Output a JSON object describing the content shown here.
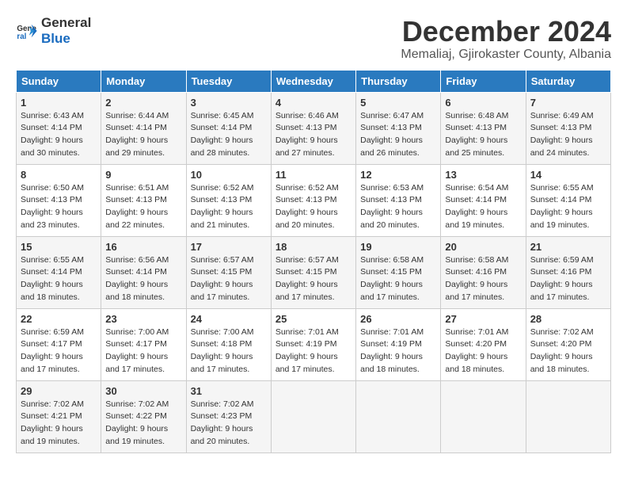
{
  "header": {
    "logo_general": "General",
    "logo_blue": "Blue",
    "month_title": "December 2024",
    "location": "Memaliaj, Gjirokaster County, Albania"
  },
  "days_of_week": [
    "Sunday",
    "Monday",
    "Tuesday",
    "Wednesday",
    "Thursday",
    "Friday",
    "Saturday"
  ],
  "weeks": [
    [
      {
        "day": "1",
        "sunrise": "6:43 AM",
        "sunset": "4:14 PM",
        "daylight": "9 hours and 30 minutes."
      },
      {
        "day": "2",
        "sunrise": "6:44 AM",
        "sunset": "4:14 PM",
        "daylight": "9 hours and 29 minutes."
      },
      {
        "day": "3",
        "sunrise": "6:45 AM",
        "sunset": "4:14 PM",
        "daylight": "9 hours and 28 minutes."
      },
      {
        "day": "4",
        "sunrise": "6:46 AM",
        "sunset": "4:13 PM",
        "daylight": "9 hours and 27 minutes."
      },
      {
        "day": "5",
        "sunrise": "6:47 AM",
        "sunset": "4:13 PM",
        "daylight": "9 hours and 26 minutes."
      },
      {
        "day": "6",
        "sunrise": "6:48 AM",
        "sunset": "4:13 PM",
        "daylight": "9 hours and 25 minutes."
      },
      {
        "day": "7",
        "sunrise": "6:49 AM",
        "sunset": "4:13 PM",
        "daylight": "9 hours and 24 minutes."
      }
    ],
    [
      {
        "day": "8",
        "sunrise": "6:50 AM",
        "sunset": "4:13 PM",
        "daylight": "9 hours and 23 minutes."
      },
      {
        "day": "9",
        "sunrise": "6:51 AM",
        "sunset": "4:13 PM",
        "daylight": "9 hours and 22 minutes."
      },
      {
        "day": "10",
        "sunrise": "6:52 AM",
        "sunset": "4:13 PM",
        "daylight": "9 hours and 21 minutes."
      },
      {
        "day": "11",
        "sunrise": "6:52 AM",
        "sunset": "4:13 PM",
        "daylight": "9 hours and 20 minutes."
      },
      {
        "day": "12",
        "sunrise": "6:53 AM",
        "sunset": "4:13 PM",
        "daylight": "9 hours and 20 minutes."
      },
      {
        "day": "13",
        "sunrise": "6:54 AM",
        "sunset": "4:14 PM",
        "daylight": "9 hours and 19 minutes."
      },
      {
        "day": "14",
        "sunrise": "6:55 AM",
        "sunset": "4:14 PM",
        "daylight": "9 hours and 19 minutes."
      }
    ],
    [
      {
        "day": "15",
        "sunrise": "6:55 AM",
        "sunset": "4:14 PM",
        "daylight": "9 hours and 18 minutes."
      },
      {
        "day": "16",
        "sunrise": "6:56 AM",
        "sunset": "4:14 PM",
        "daylight": "9 hours and 18 minutes."
      },
      {
        "day": "17",
        "sunrise": "6:57 AM",
        "sunset": "4:15 PM",
        "daylight": "9 hours and 17 minutes."
      },
      {
        "day": "18",
        "sunrise": "6:57 AM",
        "sunset": "4:15 PM",
        "daylight": "9 hours and 17 minutes."
      },
      {
        "day": "19",
        "sunrise": "6:58 AM",
        "sunset": "4:15 PM",
        "daylight": "9 hours and 17 minutes."
      },
      {
        "day": "20",
        "sunrise": "6:58 AM",
        "sunset": "4:16 PM",
        "daylight": "9 hours and 17 minutes."
      },
      {
        "day": "21",
        "sunrise": "6:59 AM",
        "sunset": "4:16 PM",
        "daylight": "9 hours and 17 minutes."
      }
    ],
    [
      {
        "day": "22",
        "sunrise": "6:59 AM",
        "sunset": "4:17 PM",
        "daylight": "9 hours and 17 minutes."
      },
      {
        "day": "23",
        "sunrise": "7:00 AM",
        "sunset": "4:17 PM",
        "daylight": "9 hours and 17 minutes."
      },
      {
        "day": "24",
        "sunrise": "7:00 AM",
        "sunset": "4:18 PM",
        "daylight": "9 hours and 17 minutes."
      },
      {
        "day": "25",
        "sunrise": "7:01 AM",
        "sunset": "4:19 PM",
        "daylight": "9 hours and 17 minutes."
      },
      {
        "day": "26",
        "sunrise": "7:01 AM",
        "sunset": "4:19 PM",
        "daylight": "9 hours and 18 minutes."
      },
      {
        "day": "27",
        "sunrise": "7:01 AM",
        "sunset": "4:20 PM",
        "daylight": "9 hours and 18 minutes."
      },
      {
        "day": "28",
        "sunrise": "7:02 AM",
        "sunset": "4:20 PM",
        "daylight": "9 hours and 18 minutes."
      }
    ],
    [
      {
        "day": "29",
        "sunrise": "7:02 AM",
        "sunset": "4:21 PM",
        "daylight": "9 hours and 19 minutes."
      },
      {
        "day": "30",
        "sunrise": "7:02 AM",
        "sunset": "4:22 PM",
        "daylight": "9 hours and 19 minutes."
      },
      {
        "day": "31",
        "sunrise": "7:02 AM",
        "sunset": "4:23 PM",
        "daylight": "9 hours and 20 minutes."
      },
      null,
      null,
      null,
      null
    ]
  ]
}
